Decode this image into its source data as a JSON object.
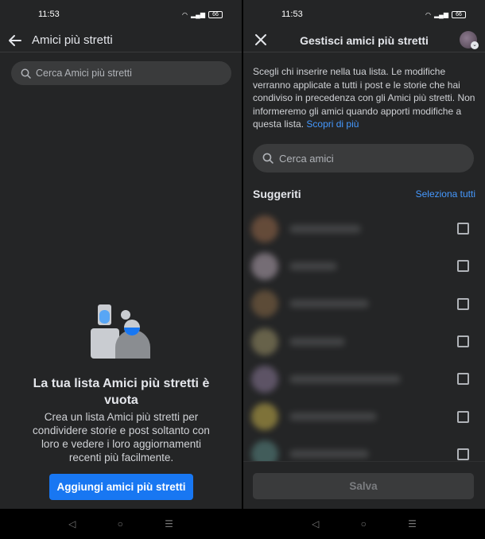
{
  "left": {
    "status": {
      "time": "11:53",
      "battery": "66"
    },
    "header": {
      "title": "Amici più stretti"
    },
    "search": {
      "placeholder": "Cerca Amici più stretti"
    },
    "empty": {
      "title": "La tua lista Amici più stretti è vuota",
      "description": "Crea un lista Amici più stretti per condividere storie e post soltanto con loro e vedere i loro aggiornamenti recenti più facilmente."
    },
    "add_button": "Aggiungi amici più stretti"
  },
  "right": {
    "status": {
      "time": "11:53",
      "battery": "66"
    },
    "header": {
      "title": "Gestisci amici più stretti"
    },
    "info": {
      "text": "Scegli chi inserire nella tua lista. Le modifiche verranno applicate a tutti i post e le storie che hai condiviso in precedenza con gli Amici più stretti. Non informeremo gli amici quando apporti modifiche a questa lista.",
      "link": "Scopri di più"
    },
    "search": {
      "placeholder": "Cerca amici"
    },
    "suggested": {
      "title": "Suggeriti",
      "select_all": "Seleziona tutti"
    },
    "save_button": "Salva"
  },
  "colors": {
    "accent": "#1877f2",
    "link": "#4599ff",
    "background": "#242526",
    "surface": "#3a3b3c"
  },
  "nav": {
    "back": "◁",
    "home": "○",
    "recents": "☰"
  }
}
